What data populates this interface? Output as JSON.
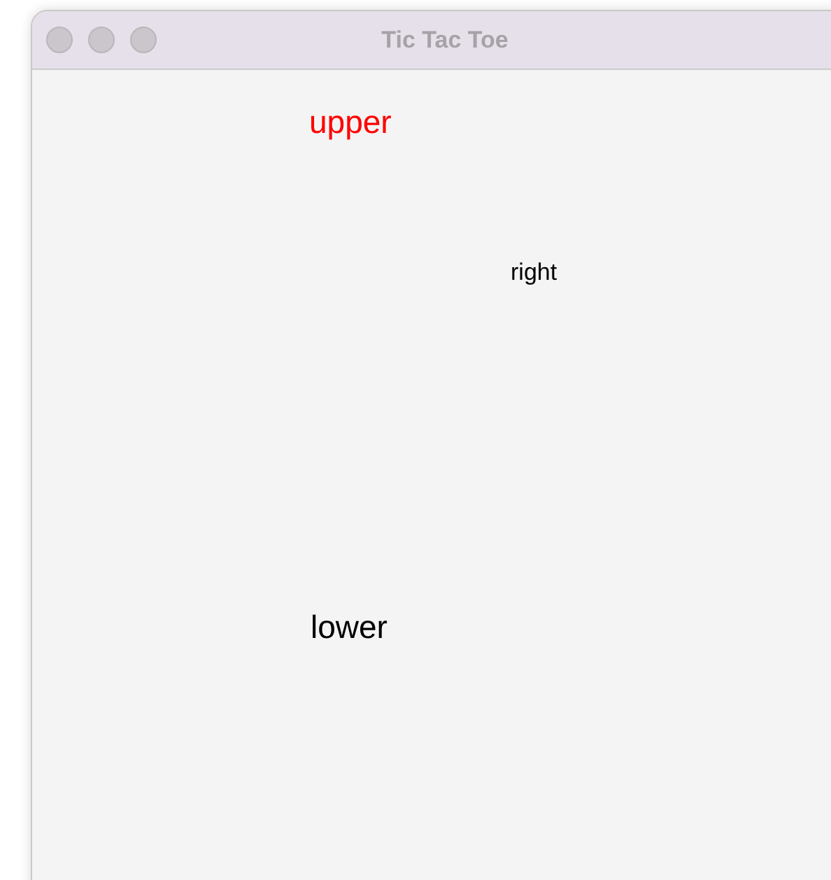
{
  "window": {
    "title": "Tic Tac Toe"
  },
  "labels": [
    {
      "text": "upper",
      "color": "#ff0000"
    },
    {
      "text": "right",
      "color": "#000000"
    },
    {
      "text": "lower",
      "color": "#000000"
    }
  ]
}
